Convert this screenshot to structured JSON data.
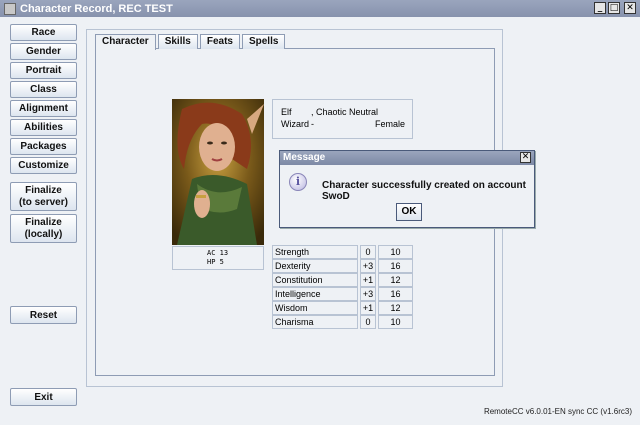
{
  "window": {
    "title": "Character Record, REC TEST",
    "min_glyph": "_",
    "max_glyph": "□",
    "close_glyph": "✕"
  },
  "left_nav": {
    "race": "Race",
    "gender": "Gender",
    "portrait": "Portrait",
    "class": "Class",
    "alignment": "Alignment",
    "abilities": "Abilities",
    "packages": "Packages",
    "customize": "Customize",
    "finalize_server": [
      "Finalize",
      "(to server)"
    ],
    "finalize_local": [
      "Finalize",
      "(locally)"
    ],
    "reset": "Reset",
    "exit": "Exit"
  },
  "tabs": [
    "Character",
    "Skills",
    "Feats",
    "Spells"
  ],
  "character": {
    "race": "Elf",
    "alignment": ", Chaotic Neutral",
    "class": "Wizard",
    "dash": "-",
    "gender": "Female",
    "ac": "AC  13",
    "hp": "HP  5"
  },
  "attributes": [
    {
      "name": "Strength",
      "mod": "0",
      "value": "10"
    },
    {
      "name": "Dexterity",
      "mod": "+3",
      "value": "16"
    },
    {
      "name": "Constitution",
      "mod": "+1",
      "value": "12"
    },
    {
      "name": "Intelligence",
      "mod": "+3",
      "value": "16"
    },
    {
      "name": "Wisdom",
      "mod": "+1",
      "value": "12"
    },
    {
      "name": "Charisma",
      "mod": "0",
      "value": "10"
    }
  ],
  "dialog": {
    "title": "Message",
    "icon": "i",
    "message": "Character successfully created on account SwoD",
    "ok": "OK",
    "close_glyph": "✕"
  },
  "status": "RemoteCC v6.0.01-EN sync CC (v1.6rc3)"
}
